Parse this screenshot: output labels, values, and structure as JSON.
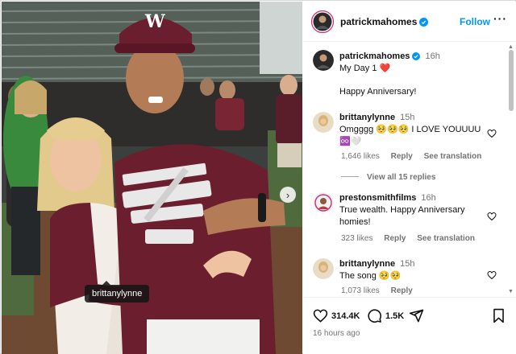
{
  "post": {
    "author": "patrickmahomes",
    "follow_label": "Follow",
    "more_label": "···",
    "photo_tag": "brittanylynne",
    "next_glyph": "›"
  },
  "caption": {
    "user": "patrickmahomes",
    "time": "16h",
    "line1": "My Day 1 ❤️",
    "line2": "Happy Anniversary!"
  },
  "comments": [
    {
      "user": "brittanylynne",
      "time": "15h",
      "text": "Omgggg 🥺🥺🥺 I LOVE YOUUUU ♾️🤍",
      "likes": "1,646 likes",
      "reply": "Reply",
      "translate": "See translation",
      "view_replies": "View all 15 replies"
    },
    {
      "user": "prestonsmithfilms",
      "time": "16h",
      "text": "True wealth. Happy Anniversary homies!",
      "likes": "323 likes",
      "reply": "Reply",
      "translate": "See translation"
    },
    {
      "user": "brittanylynne",
      "time": "15h",
      "text": "The song 🥺🥺",
      "likes": "1,073 likes",
      "reply": "Reply"
    }
  ],
  "actions": {
    "likes_count": "314.4K",
    "comments_count": "1.5K",
    "posted": "16 hours ago"
  },
  "icons": {
    "like": "heart-icon",
    "comment": "comment-icon",
    "share": "send-icon",
    "save": "bookmark-icon",
    "verified": "verified-badge-icon",
    "more": "more-options-icon"
  },
  "colors": {
    "link_blue": "#0095f6",
    "verified_blue": "#0095f6",
    "secondary_text": "#737373",
    "jersey_maroon": "#6b1e2e"
  }
}
